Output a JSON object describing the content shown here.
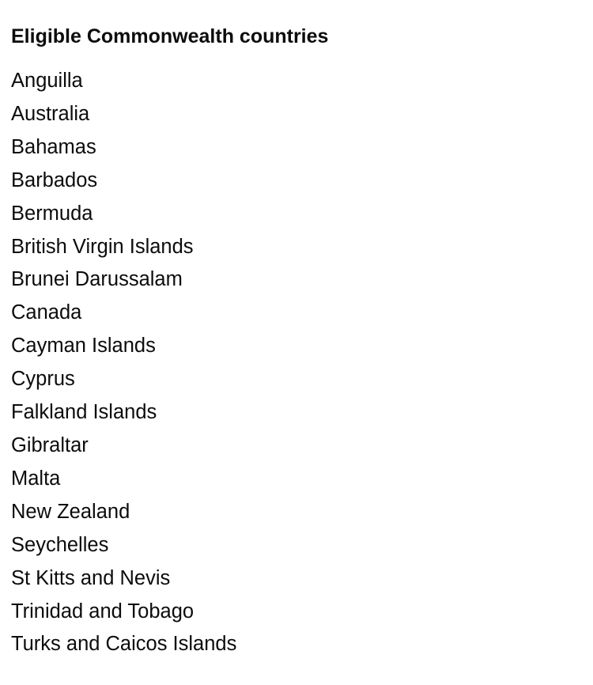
{
  "heading": "Eligible Commonwealth countries",
  "countries": [
    "Anguilla",
    "Australia",
    "Bahamas",
    "Barbados",
    "Bermuda",
    "British Virgin Islands",
    "Brunei Darussalam",
    "Canada",
    "Cayman Islands",
    "Cyprus",
    "Falkland Islands",
    "Gibraltar",
    "Malta",
    "New Zealand",
    "Seychelles",
    "St Kitts and Nevis",
    "Trinidad and Tobago",
    "Turks and Caicos Islands"
  ]
}
